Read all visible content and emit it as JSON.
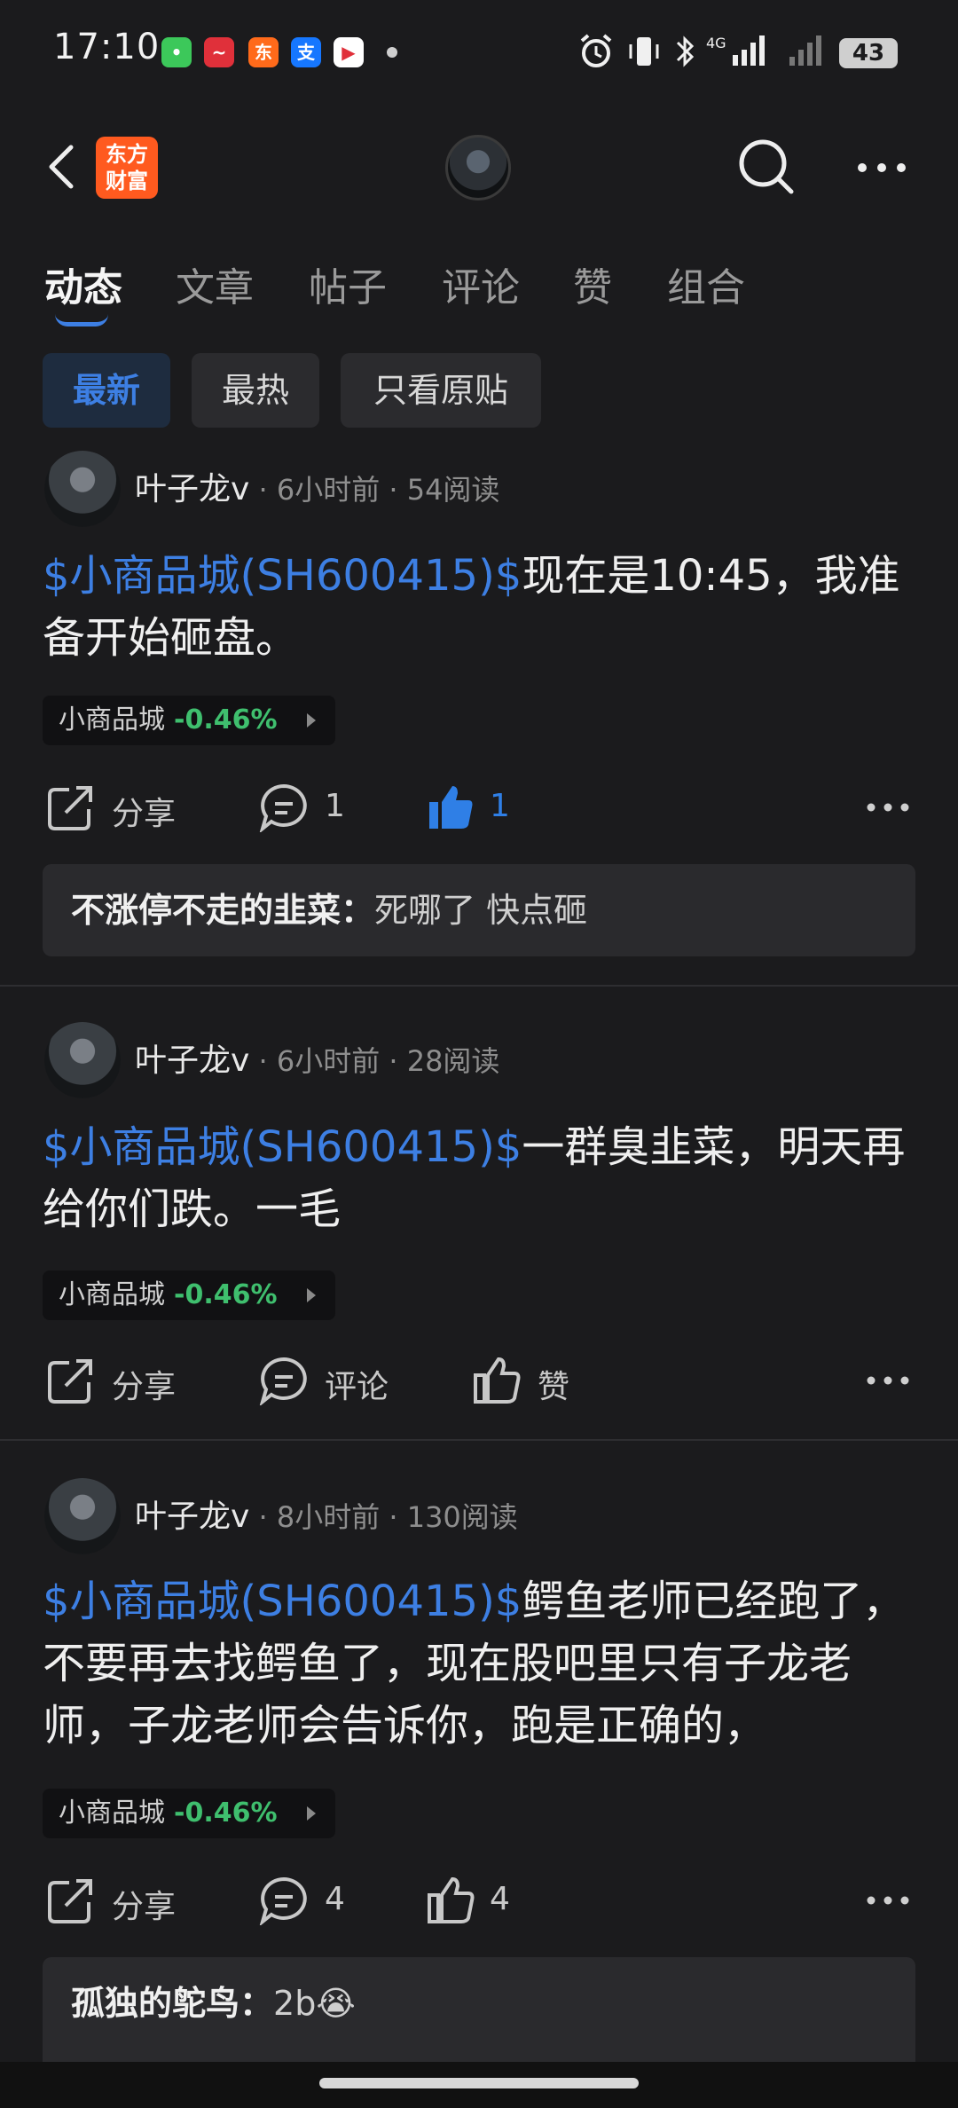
{
  "status_bar": {
    "time": "17:10",
    "battery": "43"
  },
  "header": {
    "logo_line1": "东方",
    "logo_line2": "财富"
  },
  "tabs": [
    {
      "label": "动态"
    },
    {
      "label": "文章"
    },
    {
      "label": "帖子"
    },
    {
      "label": "评论"
    },
    {
      "label": "赞"
    },
    {
      "label": "组合"
    }
  ],
  "filters": [
    {
      "label": "最新"
    },
    {
      "label": "最热"
    },
    {
      "label": "只看原贴"
    }
  ],
  "posts": [
    {
      "author": "叶子龙v",
      "meta": " · 6小时前 · 54阅读",
      "stock_tag": "$小商品城(SH600415)$",
      "text_line1": "现在是10:45，我准",
      "text_rest": "备开始砸盘。",
      "chip_name": "小商品城",
      "chip_change": "-0.46%",
      "share": "分享",
      "comments": "1",
      "likes": "1",
      "comment_user": "不涨停不走的韭菜",
      "comment_text": "死哪了 快点砸"
    },
    {
      "author": "叶子龙v",
      "meta": " · 6小时前 · 28阅读",
      "stock_tag": "$小商品城(SH600415)$",
      "text_line1": "一群臭韭菜，明天",
      "text_rest": "再给你们跌。一毛",
      "chip_name": "小商品城",
      "chip_change": "-0.46%",
      "share": "分享",
      "comments": "评论",
      "likes": "赞"
    },
    {
      "author": "叶子龙v",
      "meta": " · 8小时前 · 130阅读",
      "stock_tag": "$小商品城(SH600415)$",
      "text_line1": "鳄鱼老师已经跑",
      "text_rest": "了，不要再去找鳄鱼了，现在股吧里只有子龙老师，子龙老师会告诉你，跑是正确的，",
      "chip_name": "小商品城",
      "chip_change": "-0.46%",
      "share": "分享",
      "comments": "4",
      "likes": "4",
      "comment_user": "孤独的鸵鸟",
      "comment_text": "2b😭"
    }
  ],
  "colors": {
    "accent": "#3d7fe3",
    "up_green": "#3fbf6e",
    "background": "#1b1b1d"
  }
}
